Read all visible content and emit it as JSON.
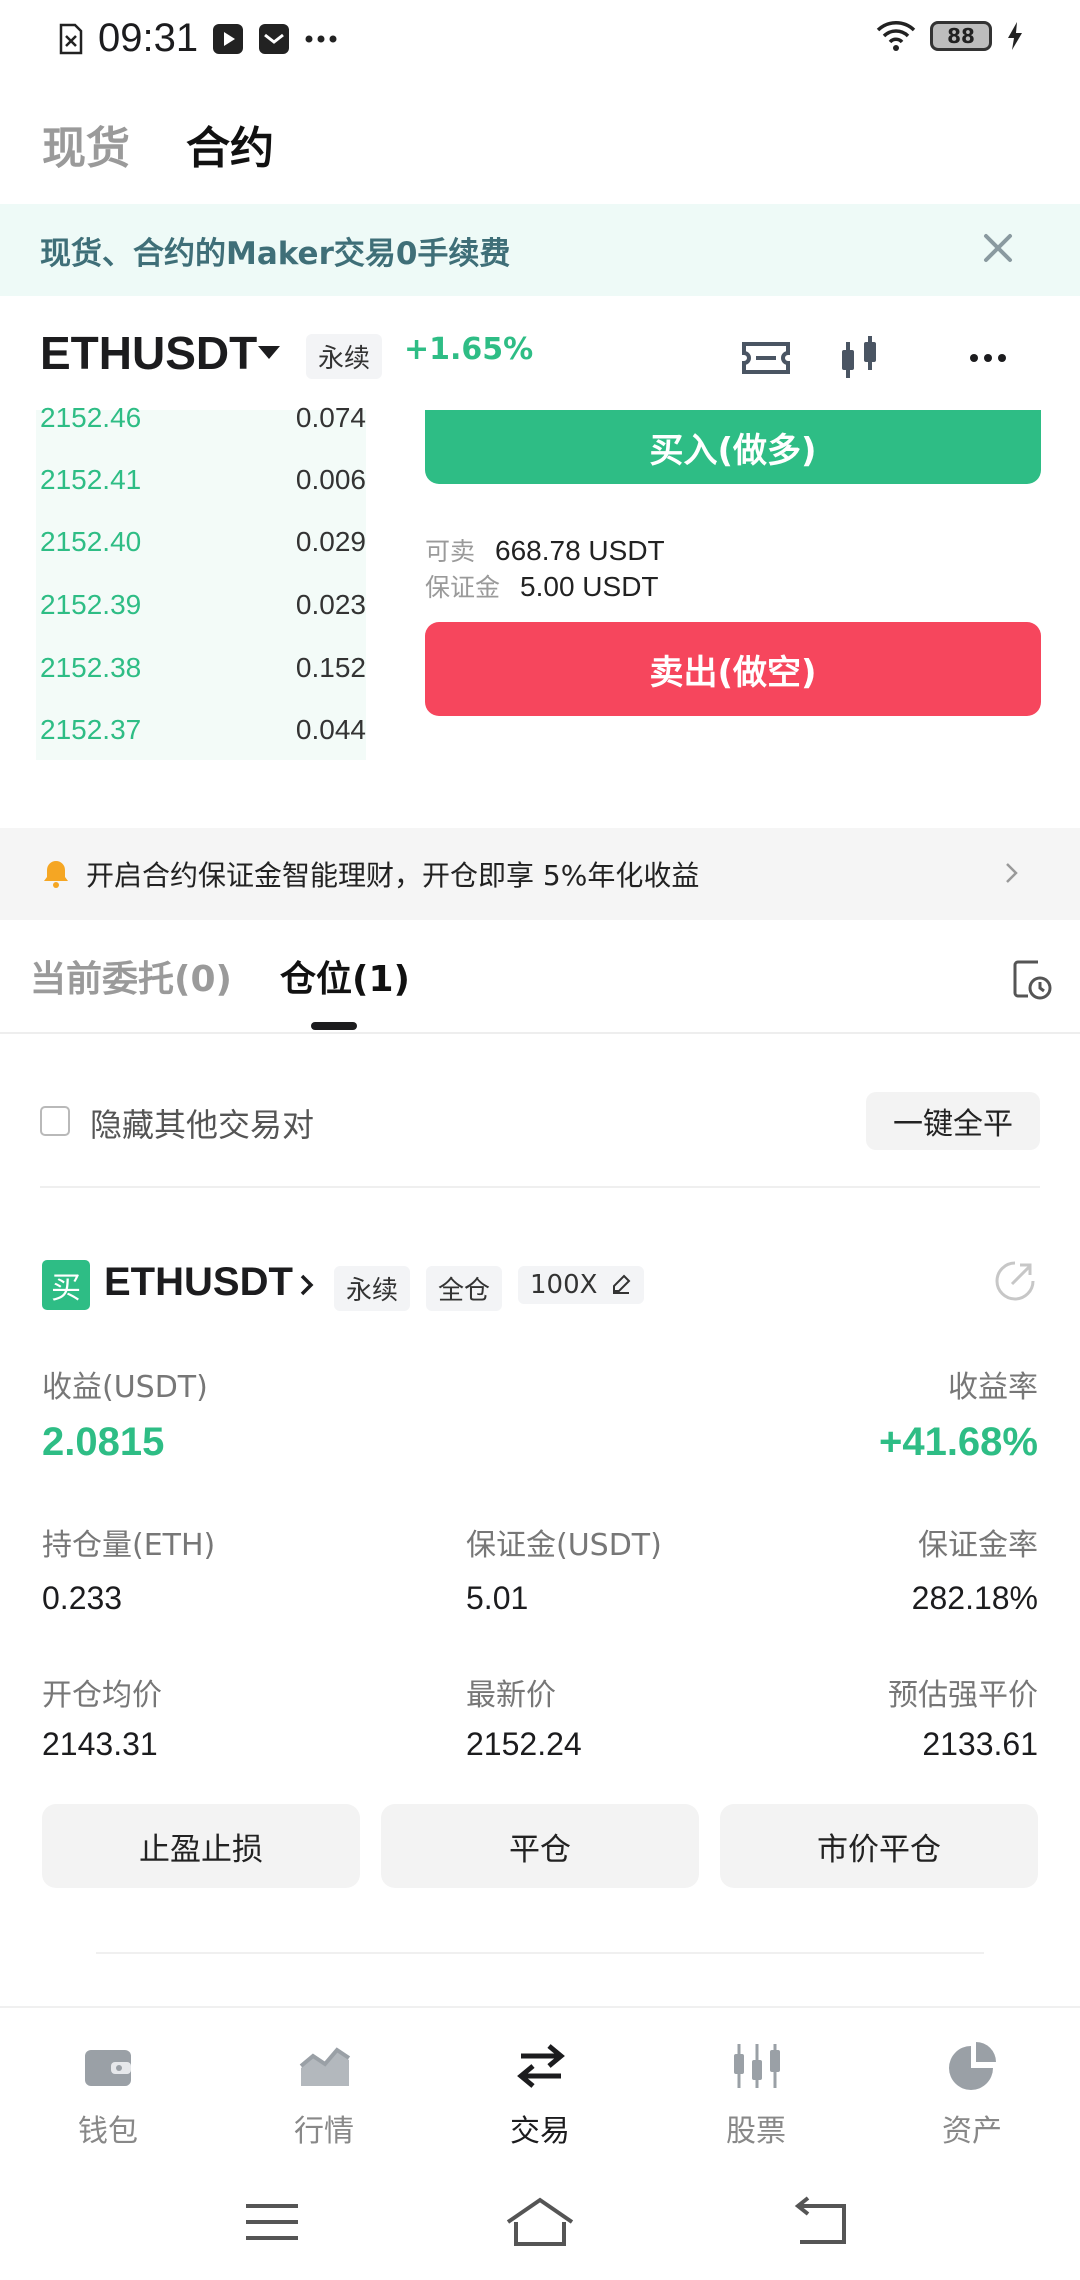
{
  "status_bar": {
    "time": "09:31",
    "battery": "88"
  },
  "top_tabs": {
    "spot": "现货",
    "contract": "合约"
  },
  "promo": {
    "text": "现货、合约的Maker交易0手续费"
  },
  "pair": {
    "symbol": "ETHUSDT",
    "type_tag": "永续",
    "change": "+1.65%"
  },
  "orderbook": {
    "rows": [
      {
        "price": "2152.46",
        "qty": "0.074"
      },
      {
        "price": "2152.41",
        "qty": "0.006"
      },
      {
        "price": "2152.40",
        "qty": "0.029"
      },
      {
        "price": "2152.39",
        "qty": "0.023"
      },
      {
        "price": "2152.38",
        "qty": "0.152"
      },
      {
        "price": "2152.37",
        "qty": "0.044"
      }
    ]
  },
  "trade": {
    "buy_label": "买入(做多)",
    "sell_label": "卖出(做空)",
    "available_label": "可卖",
    "available_value": "668.78 USDT",
    "margin_label": "保证金",
    "margin_value": "5.00 USDT"
  },
  "notice": {
    "text": "开启合约保证金智能理财，开仓即享 5%年化收益"
  },
  "position_tabs": {
    "orders": "当前委托(0)",
    "positions": "仓位(1)"
  },
  "filter": {
    "hide_label": "隐藏其他交易对",
    "close_all": "一键全平"
  },
  "position": {
    "side": "买",
    "symbol": "ETHUSDT",
    "tags": [
      "永续",
      "全仓",
      "100X"
    ],
    "pnl_label": "收益(USDT)",
    "pnl_value": "2.0815",
    "roe_label": "收益率",
    "roe_value": "+41.68%",
    "size_label": "持仓量(ETH)",
    "size_value": "0.233",
    "margin_label": "保证金(USDT)",
    "margin_value": "5.01",
    "margin_rate_label": "保证金率",
    "margin_rate_value": "282.18%",
    "entry_label": "开仓均价",
    "entry_value": "2143.31",
    "last_label": "最新价",
    "last_value": "2152.24",
    "liq_label": "预估强平价",
    "liq_value": "2133.61",
    "btn_tpsl": "止盈止损",
    "btn_close": "平仓",
    "btn_market_close": "市价平仓"
  },
  "bottom_nav": {
    "wallet": "钱包",
    "market": "行情",
    "trade": "交易",
    "stocks": "股票",
    "assets": "资产"
  },
  "colors": {
    "green": "#2ebd85",
    "red": "#f6465d",
    "banner_bg": "#eefaf7",
    "text_dark": "#1c1c1e"
  }
}
